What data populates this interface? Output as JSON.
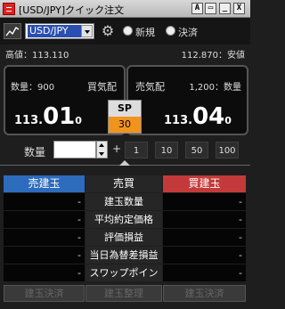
{
  "window": {
    "title": "[USD/JPY]クイック注文",
    "buttons": [
      "A",
      "▭",
      "_",
      "X"
    ]
  },
  "toolbar": {
    "pair": "USD/JPY",
    "modes": [
      {
        "label": "新規",
        "selected": false
      },
      {
        "label": "決済",
        "selected": false
      }
    ]
  },
  "hilo": {
    "high": "高値：113.110",
    "low": "112.870：安値"
  },
  "bid": {
    "qty": "数量：900",
    "label": "買気配",
    "prefix": "113.",
    "big": "01",
    "pip": "0"
  },
  "ask": {
    "qty": "1,200：数量",
    "label": "売気配",
    "prefix": "113.",
    "big": "04",
    "pip": "0"
  },
  "spread": {
    "label": "SP",
    "value": "30"
  },
  "quantity": {
    "label": "数量",
    "value": "",
    "plus": "+",
    "presets": [
      "1",
      "10",
      "50",
      "100"
    ]
  },
  "positions": {
    "left_header": "売建玉",
    "mid_header": "売買",
    "right_header": "買建玉",
    "rows": [
      {
        "label": "建玉数量",
        "left": "-",
        "right": "-"
      },
      {
        "label": "平均約定価格",
        "left": "-",
        "right": "-"
      },
      {
        "label": "評価損益",
        "left": "-",
        "right": "-"
      },
      {
        "label": "当日為替差損益",
        "left": "-",
        "right": "-"
      },
      {
        "label": "スワップポイント",
        "left": "-",
        "right": "-"
      }
    ]
  },
  "actions": {
    "sell_close": "建玉決済",
    "net_close": "建玉整理",
    "buy_close": "建玉決済"
  },
  "colors": {
    "sell_header": "#2d6bbd",
    "buy_header": "#c43a3a",
    "spread": "#f0941d"
  }
}
